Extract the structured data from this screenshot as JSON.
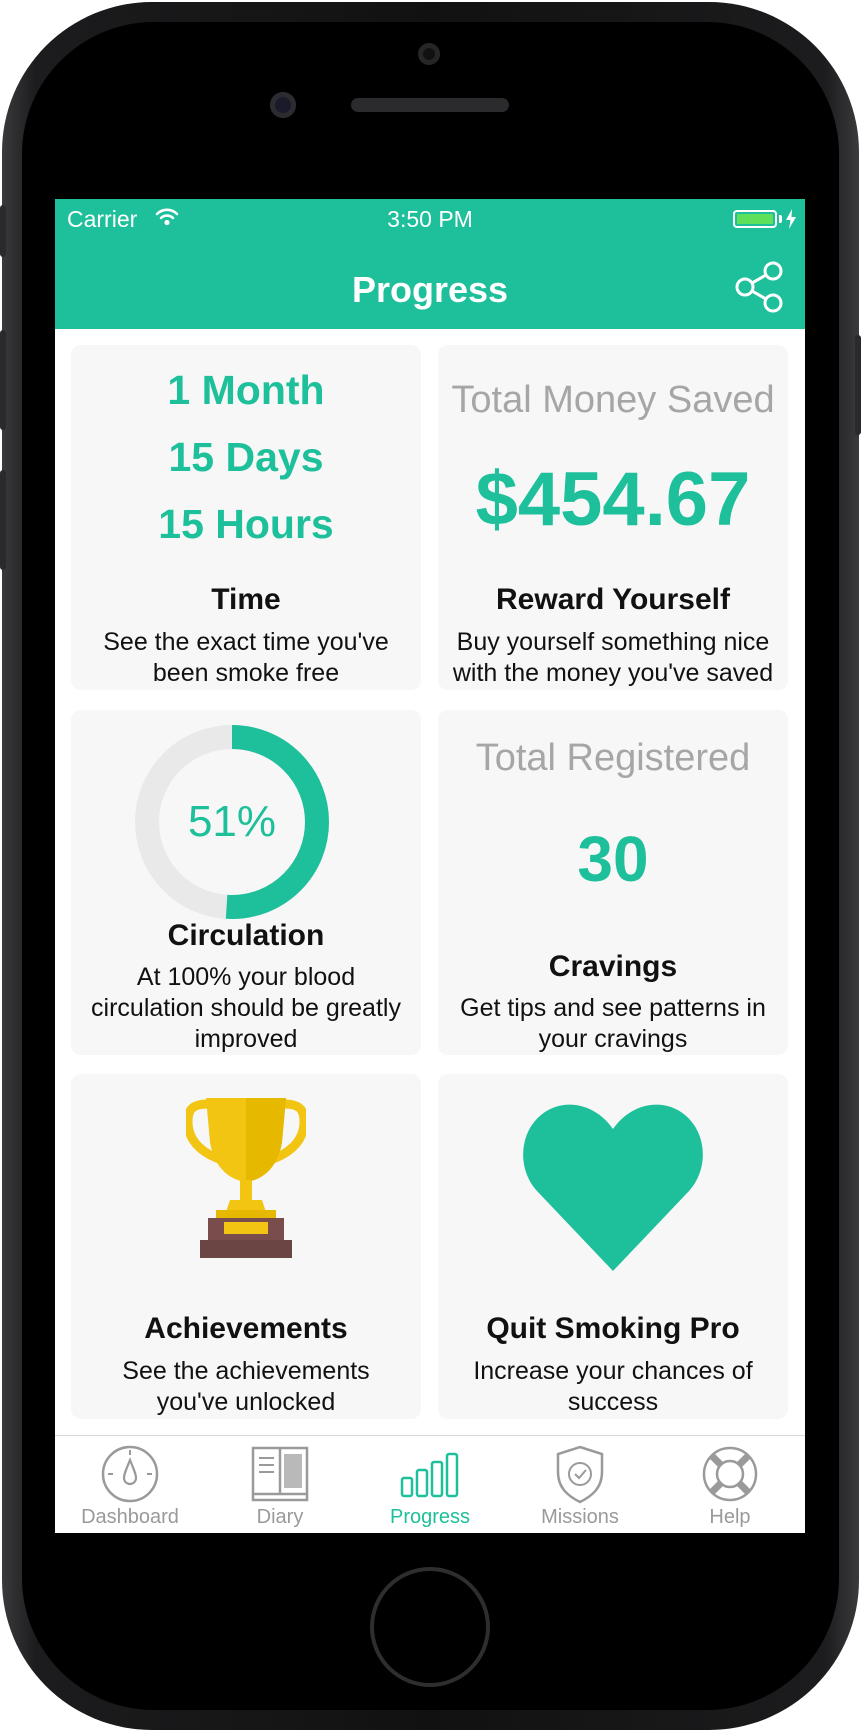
{
  "status_bar": {
    "carrier": "Carrier",
    "time": "3:50 PM",
    "battery_level": 1.0
  },
  "header": {
    "title": "Progress",
    "share_icon": "share-icon"
  },
  "colors": {
    "accent": "#1ebf9b",
    "card_bg": "#f7f7f7",
    "trophy": "#f2c512",
    "inactive": "#9a9a9a"
  },
  "cards": {
    "time": {
      "lines": [
        "1 Month",
        "15 Days",
        "15 Hours"
      ],
      "title": "Time",
      "desc_1": "See the exact time you've",
      "desc_2": "been smoke free"
    },
    "money": {
      "heading": "Total Money Saved",
      "amount": "$454.67",
      "title": "Reward Yourself",
      "desc_1": "Buy yourself something nice",
      "desc_2": "with the money you've saved"
    },
    "circulation": {
      "percent_text": "51%",
      "percent_value": 51,
      "title": "Circulation",
      "desc_1": "At 100% your blood",
      "desc_2": "circulation should be greatly",
      "desc_3": "improved"
    },
    "cravings": {
      "heading": "Total Registered",
      "count": "30",
      "title": "Cravings",
      "desc_1": "Get tips and see patterns in",
      "desc_2": "your cravings"
    },
    "achievements": {
      "icon": "trophy-icon",
      "title": "Achievements",
      "desc_1": "See the achievements",
      "desc_2": "you've unlocked"
    },
    "pro": {
      "icon": "heart-icon",
      "title": "Quit Smoking Pro",
      "desc_1": "Increase your chances of",
      "desc_2": "success"
    }
  },
  "tabs": [
    {
      "label": "Dashboard",
      "icon": "gauge-icon",
      "active": false
    },
    {
      "label": "Diary",
      "icon": "book-icon",
      "active": false
    },
    {
      "label": "Progress",
      "icon": "bars-icon",
      "active": true
    },
    {
      "label": "Missions",
      "icon": "shield-check-icon",
      "active": false
    },
    {
      "label": "Help",
      "icon": "lifebuoy-icon",
      "active": false
    }
  ]
}
